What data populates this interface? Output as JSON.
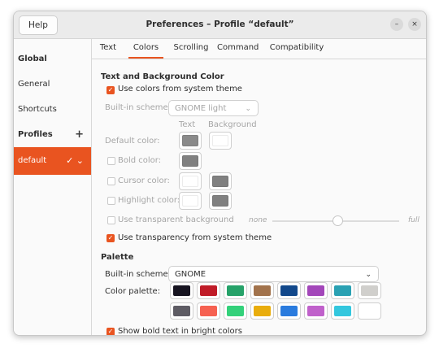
{
  "window": {
    "title": "Preferences – Profile “default”",
    "help_label": "Help",
    "minimize_symbol": "–",
    "close_symbol": "×"
  },
  "sidebar": {
    "global_label": "Global",
    "items": [
      {
        "label": "General"
      },
      {
        "label": "Shortcuts"
      }
    ],
    "profiles_label": "Profiles",
    "add_symbol": "+",
    "profile": {
      "label": "default",
      "icons": "✓ ⌄"
    }
  },
  "tabs": [
    {
      "label": "Text"
    },
    {
      "label": "Colors"
    },
    {
      "label": "Scrolling"
    },
    {
      "label": "Command"
    },
    {
      "label": "Compatibility"
    }
  ],
  "active_tab": "Colors",
  "text_bg": {
    "section_title": "Text and Background Color",
    "use_system_colors_label": "Use colors from system theme",
    "use_system_colors_checked": true,
    "builtin_label": "Built-in schemes:",
    "builtin_value": "GNOME light",
    "col_text": "Text",
    "col_background": "Background",
    "default_color_label": "Default color:",
    "bold_color_label": "Bold color:",
    "cursor_color_label": "Cursor color:",
    "highlight_color_label": "Highlight color:",
    "transparent_bg_label": "Use transparent background",
    "slider_min": "none",
    "slider_max": "full",
    "slider_value": 0.5,
    "use_transparency_label": "Use transparency from system theme",
    "use_transparency_checked": true
  },
  "palette": {
    "section_title": "Palette",
    "builtin_label": "Built-in schemes:",
    "builtin_value": "GNOME",
    "color_palette_label": "Color palette:",
    "colors_row1": [
      "#171421",
      "#c01c28",
      "#26a269",
      "#a2734c",
      "#12488b",
      "#a347ba",
      "#2aa1b3",
      "#d0cfcc"
    ],
    "colors_row2": [
      "#5e5c64",
      "#f66151",
      "#33d17a",
      "#e9ad0c",
      "#2a7bde",
      "#c061cb",
      "#33c7de",
      "#ffffff"
    ],
    "bold_bright_label": "Show bold text in bright colors",
    "bold_bright_checked": true
  },
  "colors": {
    "accent": "#e95420",
    "default_text": "#8a8a8a",
    "default_bg": "#ffffff",
    "bold_text": "#808080",
    "cursor_text": "#ffffff",
    "cursor_bg": "#808080",
    "highlight_text": "#ffffff",
    "highlight_bg": "#808080"
  }
}
